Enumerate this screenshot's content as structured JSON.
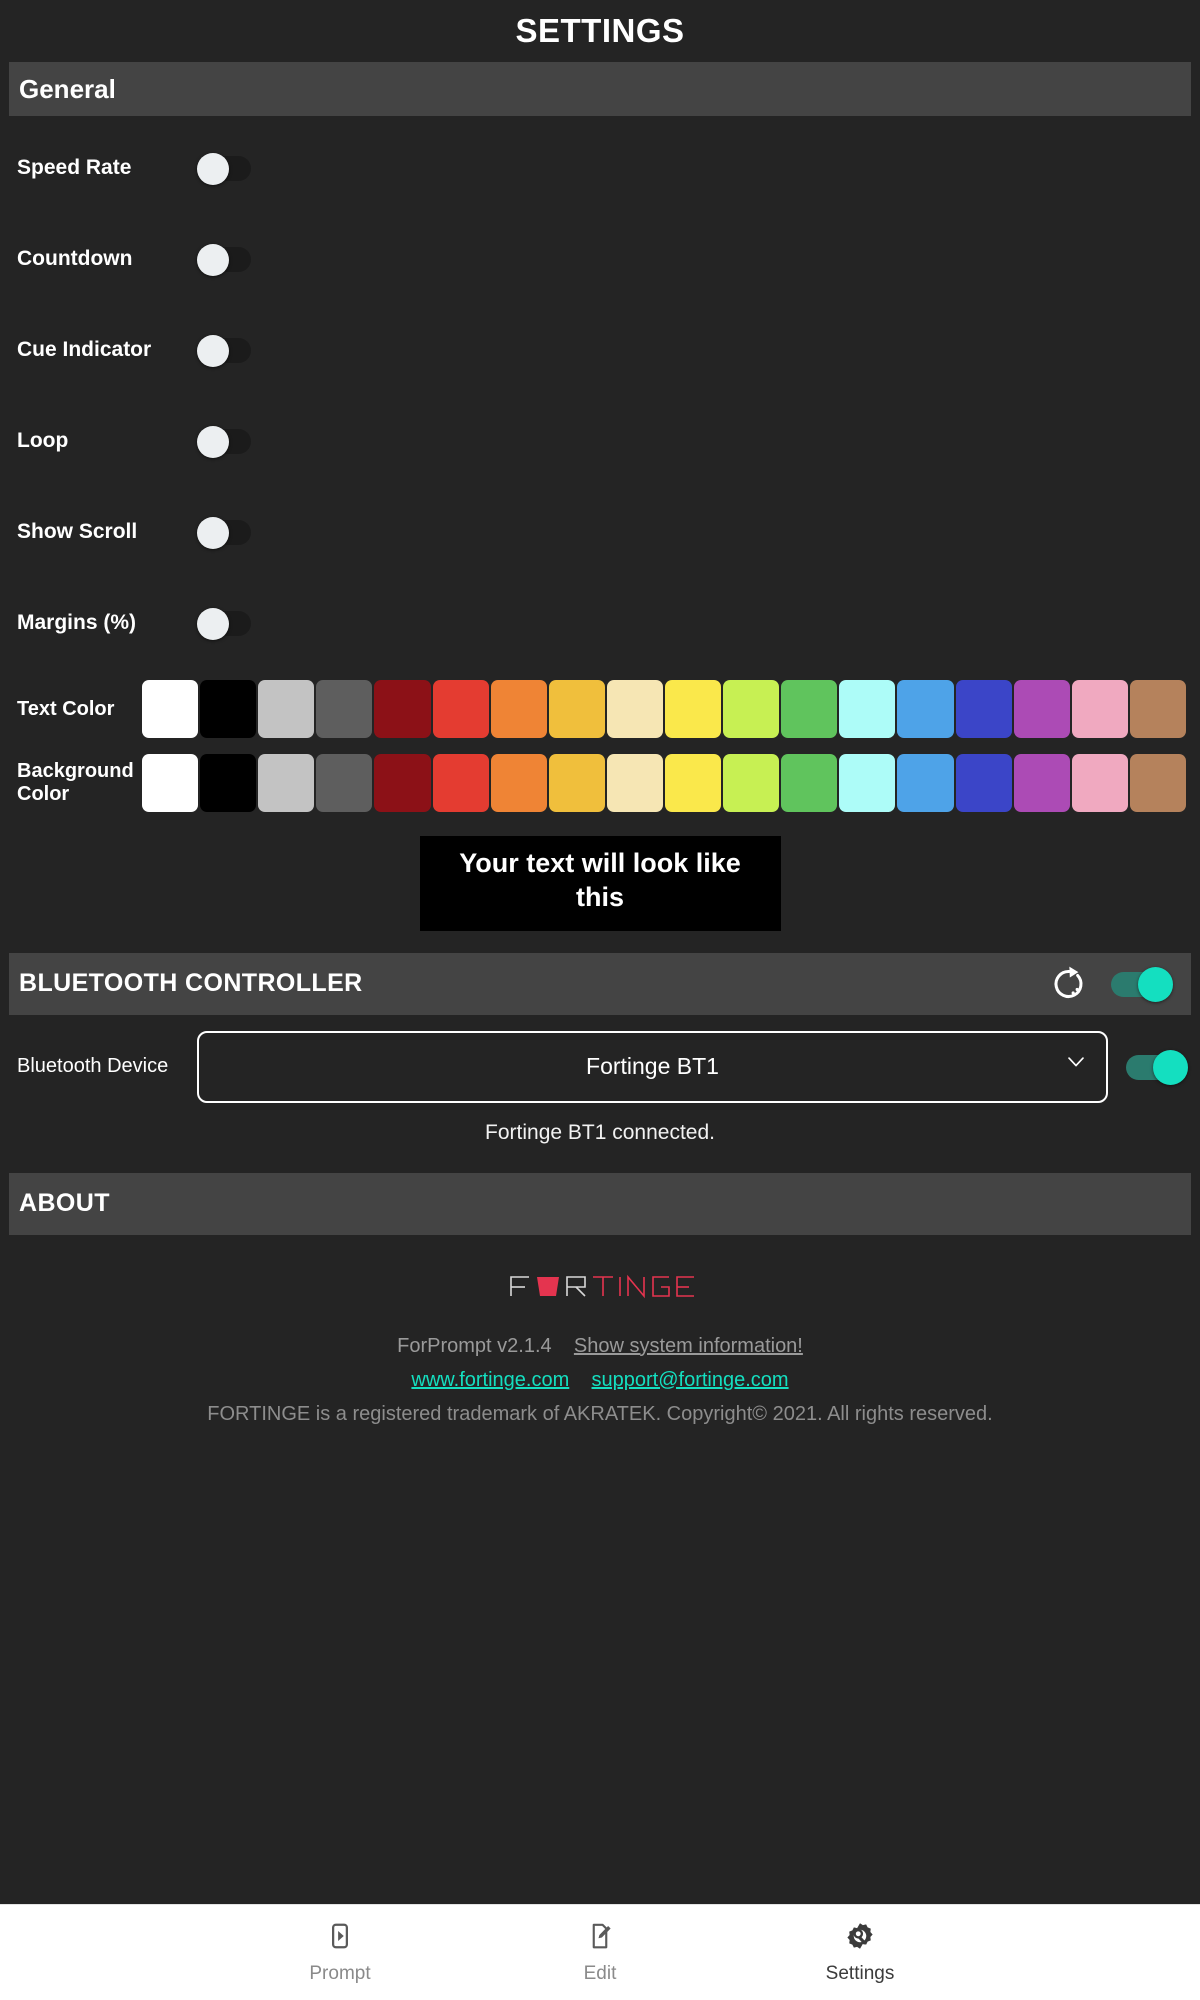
{
  "header": {
    "title": "SETTINGS"
  },
  "general": {
    "section_label": "General",
    "rows": [
      {
        "label": "Speed Rate",
        "icon": "toggle-off-icon"
      },
      {
        "label": "Countdown",
        "icon": "toggle-off-icon"
      },
      {
        "label": "Cue Indicator",
        "icon": "toggle-off-icon"
      },
      {
        "label": "Loop",
        "icon": "toggle-off-icon"
      },
      {
        "label": "Show Scroll",
        "icon": "toggle-off-icon"
      },
      {
        "label": "Margins (%)",
        "icon": "toggle-off-icon"
      }
    ],
    "text_color": {
      "label": "Text Color",
      "selected": "#ffffff",
      "swatches": [
        "#ffffff",
        "#000000",
        "#c3c3c3",
        "#5e5e5e",
        "#8c1117",
        "#e43c31",
        "#ef8435",
        "#f0bf3c",
        "#f6e6b4",
        "#fae84b",
        "#c7f053",
        "#60c45d",
        "#adfcf8",
        "#4ea3e8",
        "#3b45c8",
        "#ac4bb5",
        "#f0a9c0",
        "#b5825c"
      ]
    },
    "background_color": {
      "label": "Background Color",
      "selected": "#000000",
      "swatches": [
        "#ffffff",
        "#000000",
        "#c3c3c3",
        "#5e5e5e",
        "#8c1117",
        "#e43c31",
        "#ef8435",
        "#f0bf3c",
        "#f6e6b4",
        "#fae84b",
        "#c7f053",
        "#60c45d",
        "#adfcf8",
        "#4ea3e8",
        "#3b45c8",
        "#ac4bb5",
        "#f0a9c0",
        "#b5825c"
      ]
    },
    "preview": {
      "text": "Your text will look like this",
      "text_color": "#ffffff",
      "background_color": "#000000"
    }
  },
  "bluetooth": {
    "section_label": "BLUETOOTH CONTROLLER",
    "refresh_icon": "refresh-scan-icon",
    "enabled": true,
    "device_row_label": "Bluetooth Device",
    "selected_device": "Fortinge BT1",
    "device_options": [
      "Fortinge BT1"
    ],
    "device_enabled": true,
    "status": "Fortinge BT1 connected."
  },
  "about": {
    "section_label": "ABOUT",
    "logo_text_1": "FOR",
    "logo_text_2": "TINGE",
    "logo_accent_color": "#e4344f",
    "version": "ForPrompt v2.1.4",
    "system_info_link": "Show system information!",
    "website_link": "www.fortinge.com",
    "support_link": "support@fortinge.com",
    "trademark": "FORTINGE is a registered trademark of AKRATEK. Copyright© 2021. All rights reserved."
  },
  "bottom_nav": {
    "items": [
      {
        "label": "Prompt",
        "icon": "prompt-play-icon",
        "active": false
      },
      {
        "label": "Edit",
        "icon": "edit-pencil-icon",
        "active": false
      },
      {
        "label": "Settings",
        "icon": "settings-gear-icon",
        "active": true
      }
    ]
  }
}
